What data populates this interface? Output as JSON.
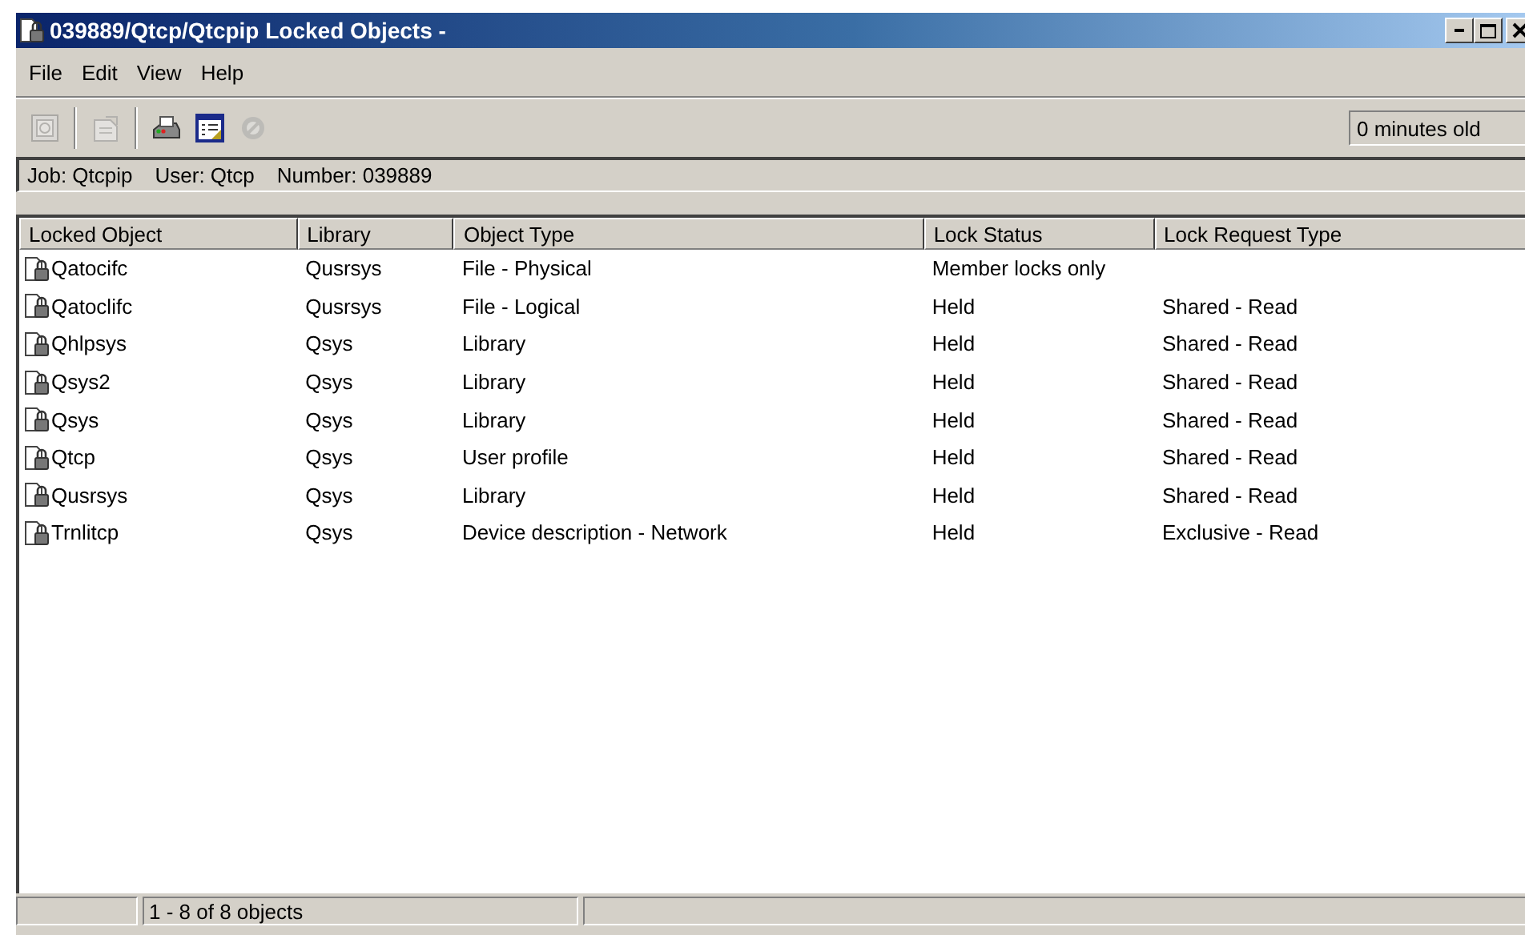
{
  "window": {
    "title": "039889/Qtcp/Qtcpip Locked Objects -"
  },
  "menu": [
    "File",
    "Edit",
    "View",
    "Help"
  ],
  "toolbar": [
    {
      "kind": "properties",
      "disabled": true
    },
    {
      "kind": "separator"
    },
    {
      "kind": "details",
      "disabled": true
    },
    {
      "kind": "separator"
    },
    {
      "kind": "printer",
      "disabled": false
    },
    {
      "kind": "columns",
      "disabled": false
    },
    {
      "kind": "stop",
      "disabled": true
    }
  ],
  "age": "0 minutes old",
  "job_info": {
    "job": "Job: Qtcpip",
    "user": "User: Qtcp",
    "number": "Number: 039889"
  },
  "table": {
    "columns": [
      "Locked Object",
      "Library",
      "Object Type",
      "Lock Status",
      "Lock Request Type"
    ],
    "rows": [
      [
        "Qatocifc",
        "Qusrsys",
        "File - Physical",
        "Member locks only",
        ""
      ],
      [
        "Qatoclifc",
        "Qusrsys",
        "File - Logical",
        "Held",
        "Shared - Read"
      ],
      [
        "Qhlpsys",
        "Qsys",
        "Library",
        "Held",
        "Shared - Read"
      ],
      [
        "Qsys2",
        "Qsys",
        "Library",
        "Held",
        "Shared - Read"
      ],
      [
        "Qsys",
        "Qsys",
        "Library",
        "Held",
        "Shared - Read"
      ],
      [
        "Qtcp",
        "Qsys",
        "User profile",
        "Held",
        "Shared - Read"
      ],
      [
        "Qusrsys",
        "Qsys",
        "Library",
        "Held",
        "Shared - Read"
      ],
      [
        "Trnlitcp",
        "Qsys",
        "Device description - Network",
        "Held",
        "Exclusive - Read"
      ]
    ]
  },
  "status_bar": {
    "count": "1 - 8 of 8 objects"
  }
}
